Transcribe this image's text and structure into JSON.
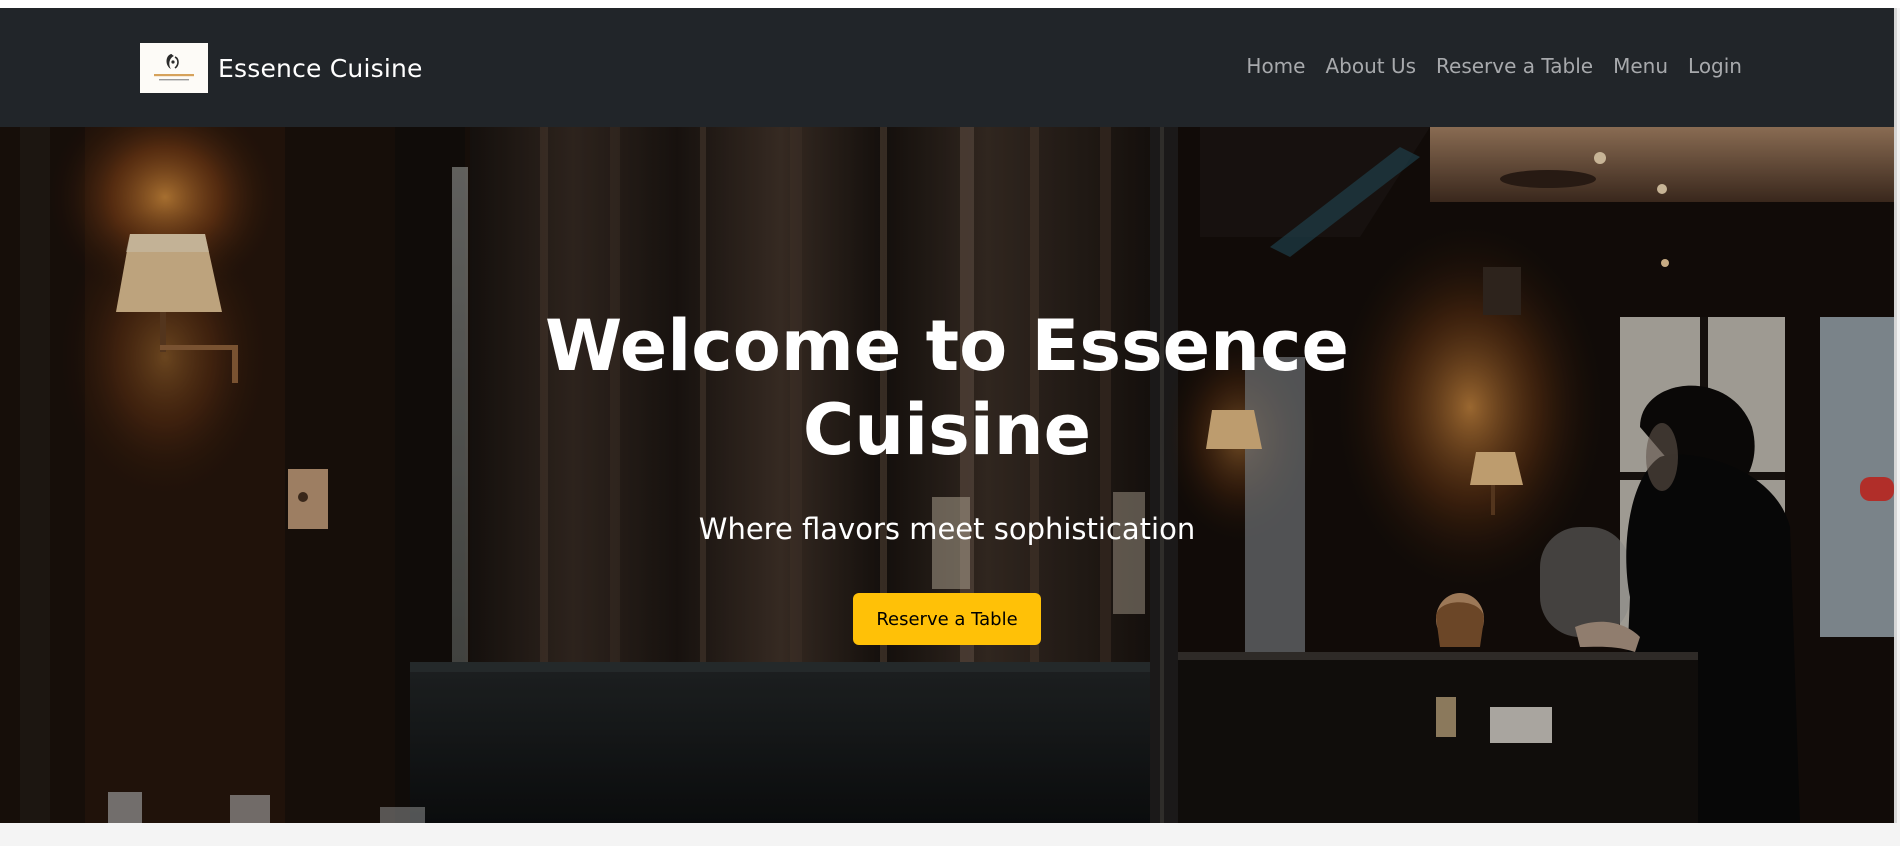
{
  "brand": {
    "name": "Essence Cuisine",
    "logo_alt": "Essence Cuisine logo"
  },
  "nav": {
    "items": [
      {
        "label": "Home"
      },
      {
        "label": "About Us"
      },
      {
        "label": "Reserve a Table"
      },
      {
        "label": "Menu"
      },
      {
        "label": "Login"
      }
    ]
  },
  "hero": {
    "title": "Welcome to Essence Cuisine",
    "subtitle": "Where flavors meet sophistication",
    "cta_label": "Reserve a Table"
  },
  "colors": {
    "navbar_bg": "#212529",
    "nav_link": "#a7a9ac",
    "cta_bg": "#ffc107",
    "hero_text": "#ffffff"
  }
}
